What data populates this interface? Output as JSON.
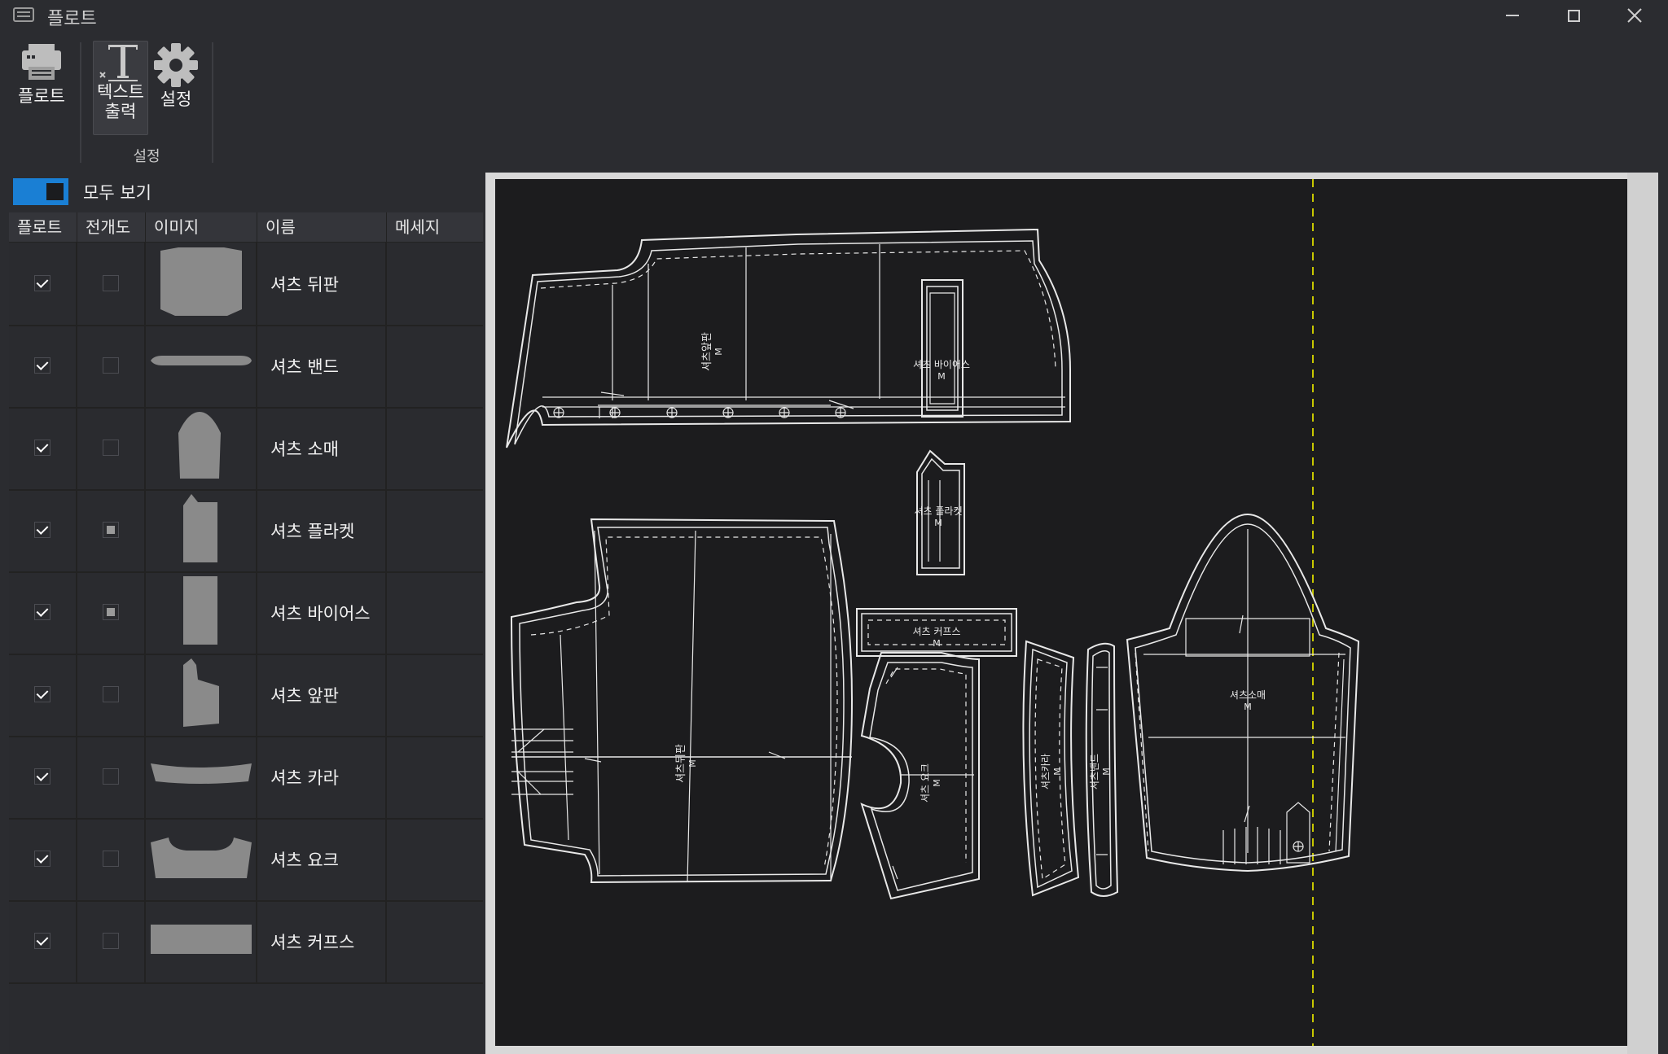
{
  "window": {
    "title": "플로트"
  },
  "ribbon": {
    "plot_label": "플로트",
    "text_output_label_line1": "텍스트",
    "text_output_label_line2": "출력",
    "settings_label": "설정",
    "group_label": "설정"
  },
  "filter": {
    "show_all_label": "모두 보기",
    "show_all_on": true
  },
  "table": {
    "columns": [
      "플로트",
      "전개도",
      "이미지",
      "이름",
      "메세지"
    ],
    "rows": [
      {
        "plot": true,
        "unfold": "unchecked",
        "name": "셔츠 뒤판",
        "message": ""
      },
      {
        "plot": true,
        "unfold": "unchecked",
        "name": "셔츠 밴드",
        "message": ""
      },
      {
        "plot": true,
        "unfold": "unchecked",
        "name": "셔츠 소매",
        "message": ""
      },
      {
        "plot": true,
        "unfold": "indeterminate",
        "name": "셔츠 플라켓",
        "message": ""
      },
      {
        "plot": true,
        "unfold": "indeterminate",
        "name": "셔츠 바이어스",
        "message": ""
      },
      {
        "plot": true,
        "unfold": "unchecked",
        "name": "셔츠 앞판",
        "message": ""
      },
      {
        "plot": true,
        "unfold": "unchecked",
        "name": "셔츠 카라",
        "message": ""
      },
      {
        "plot": true,
        "unfold": "unchecked",
        "name": "셔츠 요크",
        "message": ""
      },
      {
        "plot": true,
        "unfold": "unchecked",
        "name": "셔츠 커프스",
        "message": ""
      }
    ]
  },
  "canvas": {
    "pieces": [
      {
        "label": "셔츠앞판",
        "size": "M"
      },
      {
        "label": "셔츠 바이어스",
        "size": "M"
      },
      {
        "label": "셔츠 플라켓",
        "size": "M"
      },
      {
        "label": "셔츠 커프스",
        "size": "M"
      },
      {
        "label": "셔츠뒤판",
        "size": "M"
      },
      {
        "label": "셔츠 요크",
        "size": "M"
      },
      {
        "label": "셔츠카라",
        "size": "M"
      },
      {
        "label": "셔츠밴드",
        "size": "M"
      },
      {
        "label": "셔츠소매",
        "size": "M"
      }
    ]
  },
  "colors": {
    "accent": "#1a7fd4",
    "background": "#2b2c30",
    "canvas": "#1c1c1e",
    "pattern_line": "#e8e8e8",
    "marker_line": "#c8c800"
  }
}
